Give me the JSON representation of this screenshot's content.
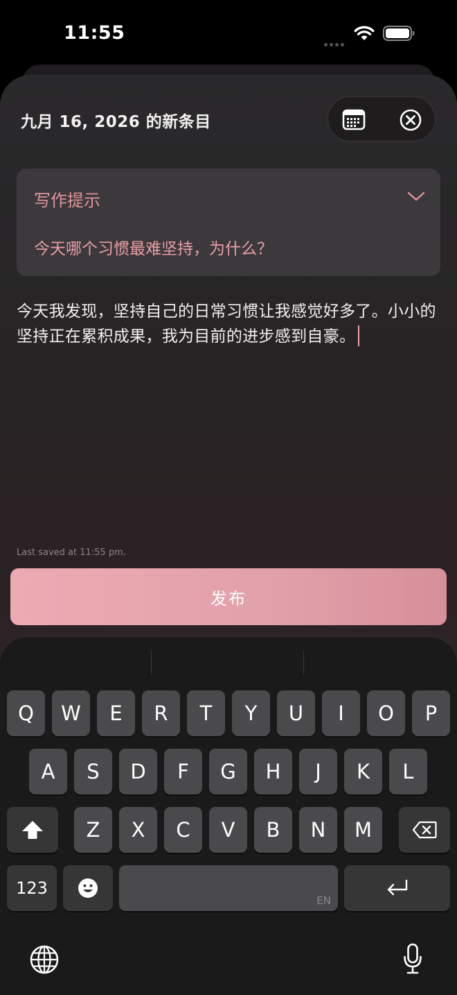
{
  "status_bar": {
    "time": "11:55"
  },
  "header": {
    "title": "九月 16, 2026 的新条目",
    "calendar_icon": "calendar-icon",
    "close_icon": "close-circle-icon"
  },
  "prompt_card": {
    "heading": "写作提示",
    "question": "今天哪个习惯最难坚持，为什么？",
    "chevron_icon": "chevron-down-icon"
  },
  "entry": {
    "text": "今天我发现，坚持自己的日常习惯让我感觉好多了。小小的坚持正在累积成果，我为目前的进步感到自豪。"
  },
  "save_status": "Last saved at 11:55 pm.",
  "publish_label": "发布",
  "colors": {
    "accent": "#E2959F",
    "button_gradient_start": "#EEAAB3",
    "button_gradient_end": "#D78F99",
    "card_bg": "#3B393B"
  },
  "keyboard": {
    "row1": [
      "Q",
      "W",
      "E",
      "R",
      "T",
      "Y",
      "U",
      "I",
      "O",
      "P"
    ],
    "row2": [
      "A",
      "S",
      "D",
      "F",
      "G",
      "H",
      "J",
      "K",
      "L"
    ],
    "row3": [
      "Z",
      "X",
      "C",
      "V",
      "B",
      "N",
      "M"
    ],
    "numbers_label": "123",
    "space_sub_label": "EN",
    "shift_icon": "shift-icon",
    "delete_icon": "backspace-icon",
    "emoji_icon": "emoji-icon",
    "return_icon": "return-icon",
    "globe_icon": "globe-icon",
    "mic_icon": "microphone-icon"
  }
}
